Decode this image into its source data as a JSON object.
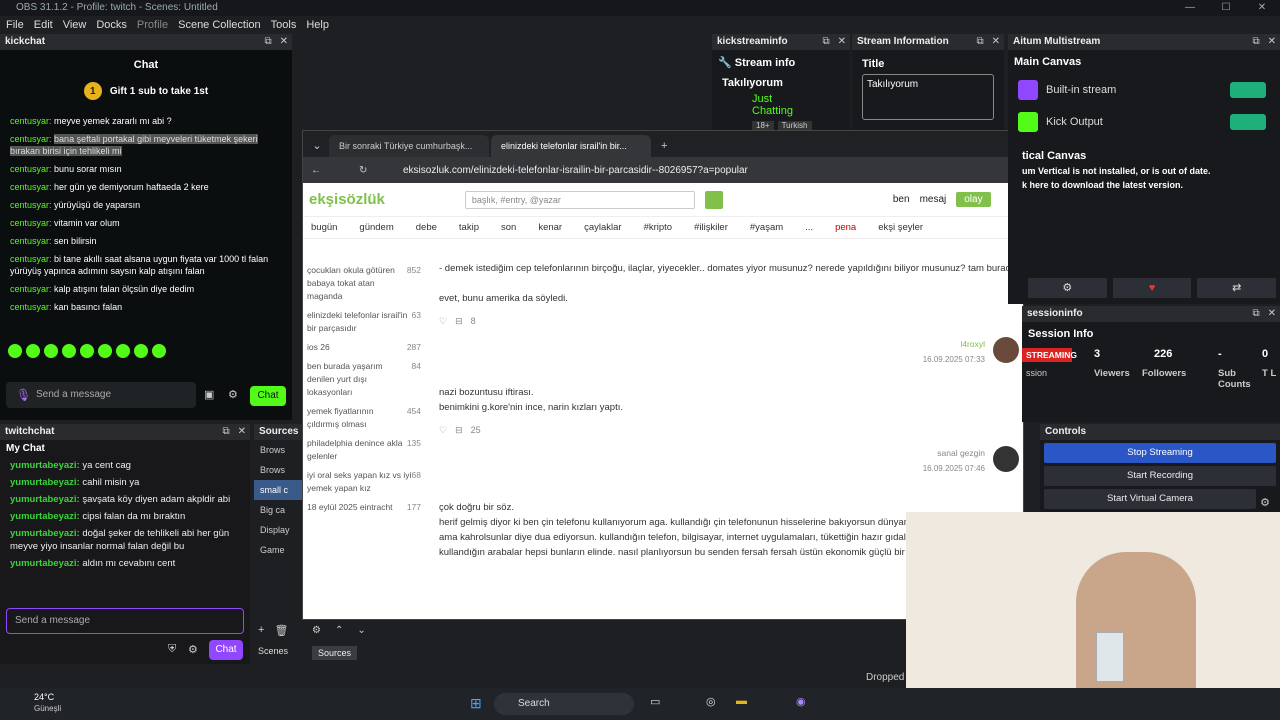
{
  "window": {
    "title": "OBS 31.1.2 - Profile: twitch - Scenes: Untitled"
  },
  "menu": [
    "File",
    "Edit",
    "View",
    "Docks",
    "Profile",
    "Scene Collection",
    "Tools",
    "Help"
  ],
  "kick": {
    "dock_title": "kickchat",
    "title": "Chat",
    "gift": "Gift 1 sub to take 1st",
    "coin": "1",
    "messages": [
      {
        "user": "centusyar:",
        "text": "meyve yemek zararlı mı abi ?"
      },
      {
        "user": "centusyar:",
        "text": "bana şeftali portakal gibi meyveleri tüketmek şekeri bırakan birisi için tehlikeli mi"
      },
      {
        "user": "centusyar:",
        "text": "bunu sorar mısın"
      },
      {
        "user": "centusyar:",
        "text": "her gün ye demiyorum haftaeda 2 kere"
      },
      {
        "user": "centusyar:",
        "text": "yürüyüşü de yaparsın"
      },
      {
        "user": "centusyar:",
        "text": "vitamin var olum"
      },
      {
        "user": "centusyar:",
        "text": "sen bilirsin"
      },
      {
        "user": "centusyar:",
        "text": "bi tane akıllı saat alsana uygun fiyata var 1000 tl falan yürüyüş yapınca adımını saysın kalp atışını falan"
      },
      {
        "user": "centusyar:",
        "text": "kalp atışını falan ölçsün diye dedim"
      },
      {
        "user": "centusyar:",
        "text": "kan basıncı falan"
      }
    ],
    "input_placeholder": "Send a message",
    "chat_button": "Chat"
  },
  "twitch": {
    "dock_title": "twitchchat",
    "title": "My Chat",
    "messages": [
      {
        "user": "yumurtabeyazi:",
        "text": "ya cent cag"
      },
      {
        "user": "yumurtabeyazi:",
        "text": "cahil misin ya"
      },
      {
        "user": "yumurtabeyazi:",
        "text": "şavşata köy diyen adam akpldir abi"
      },
      {
        "user": "yumurtabeyazi:",
        "text": "cipsi falan da mı bıraktın"
      },
      {
        "user": "yumurtabeyazi:",
        "text": "doğal şeker de tehlikeli abi her gün meyve yiyo insanlar normal falan değil bu"
      },
      {
        "user": "yumurtabeyazi:",
        "text": "aldın mı cevabını cent"
      }
    ],
    "input_placeholder": "Send a message",
    "chat_button": "Chat"
  },
  "sources": {
    "title": "Sources",
    "items": [
      "Brows",
      "Brows",
      "small c",
      "Big ca",
      "Display",
      "Game"
    ],
    "tabs": [
      "Scenes",
      "Sources"
    ]
  },
  "browser": {
    "tabs": [
      "Bir sonraki Türkiye cumhurbaşk...",
      "elinizdeki telefonlar israil'in bir..."
    ],
    "url": "eksisozluk.com/elinizdeki-telefonlar-israilin-bir-parcasidir--8026957?a=popular",
    "logo": "ekşisözlük",
    "search_placeholder": "başlık, #entry, @yazar",
    "user_links": [
      "ben",
      "mesaj",
      "olay"
    ],
    "nav": [
      "bugün",
      "gündem",
      "debe",
      "takip",
      "son",
      "kenar",
      "çaylaklar",
      "#kripto",
      "#ilişkiler",
      "#yaşam",
      "...",
      "pena",
      "ekşi şeyler"
    ],
    "left": [
      {
        "t": "çocukları okula götüren babaya tokat atan maganda",
        "n": "852"
      },
      {
        "t": "elinizdeki telefonlar israil'in bir parçasıdır",
        "n": "63"
      },
      {
        "t": "ios 26",
        "n": "287"
      },
      {
        "t": "ben burada yaşarım denilen yurt dışı lokasyonları",
        "n": "84"
      },
      {
        "t": "yemek fiyatlarının çıldırmış olması",
        "n": "454"
      },
      {
        "t": "philadelphia denince akla gelenler",
        "n": "135"
      },
      {
        "t": "iyi oral seks yapan kız vs iyi yemek yapan kız",
        "n": "68"
      },
      {
        "t": "18 eylül 2025 eintracht",
        "n": "177"
      }
    ],
    "entries": [
      {
        "text": "- demek istediğim cep telefonlarının birçoğu, ilaçlar, yiyecekler.. domates yiyor musunuz? nerede yapıldığını biliyor musunuz? tam burada.",
        "text2": "evet, bunu amerika da söyledi.",
        "fav": "8",
        "author": "l4roxyl",
        "date": "16.09.2025 07:33"
      },
      {
        "text": "nazi bozuntusu iftirası.",
        "text2": "benimkini g.kore'nin ince, narin kızları yaptı.",
        "fav": "25",
        "author": "sanal gezgin",
        "date": "16.09.2025 07:46"
      },
      {
        "text": "çok doğru bir söz.",
        "text2": "herif gelmiş diyor ki ben çin telefonu kullanıyorum aga. kullandığı çin telefonunun hisselerine bakıyorsun dünyanın %70'i adamların elinde ama kahrolsunlar diye dua ediyorsun. kullandığın telefon, bilgisayar, internet uygulamaları, tükettiğin hazır gıdalar, giysiler, aksesuarlar, kullandığın arabalar hepsi bunların elinde. nasıl planlıyorsun bu senden fersah fersah üstün ekonomik güçlü bir topluluğu?",
        "fav": "",
        "author": "",
        "date": ""
      }
    ]
  },
  "kickstream": {
    "dock_title": "kickstreaminfo",
    "title": "Stream info",
    "stream_title": "Takılıyorum",
    "category": "Just Chatting",
    "badges": [
      "18+",
      "Turkish"
    ]
  },
  "streaminfo": {
    "dock_title": "Stream Information",
    "label": "Title",
    "value": "Takılıyorum"
  },
  "aitum": {
    "dock_title": "Aitum Multistream",
    "main": "Main Canvas",
    "outputs": [
      "Built-in stream",
      "Kick Output"
    ],
    "vertical": "tical Canvas",
    "warn1": "um Vertical is not installed, or is out of date.",
    "warn2": "k here to download the latest version."
  },
  "session": {
    "dock_title": "sessioninfo",
    "title": "Session Info",
    "status": "STREAMING",
    "status_sub": "ssion",
    "stats": [
      {
        "v": "3",
        "l": "Viewers"
      },
      {
        "v": "226",
        "l": "Followers"
      },
      {
        "v": "-",
        "l": "Sub Counts"
      },
      {
        "v": "0",
        "l": "T L"
      }
    ]
  },
  "controls": {
    "title": "Controls",
    "buttons": [
      "Stop Streaming",
      "Start Recording",
      "Start Virtual Camera"
    ],
    "dropped": "Dropped"
  },
  "taskbar": {
    "weather": "24°C",
    "weather_sub": "Güneşli",
    "search": "Search"
  },
  "colors": {
    "kick": "#53fc18",
    "twitch": "#9147ff",
    "eksi": "#81c14b",
    "stop": "#2a56c6"
  }
}
